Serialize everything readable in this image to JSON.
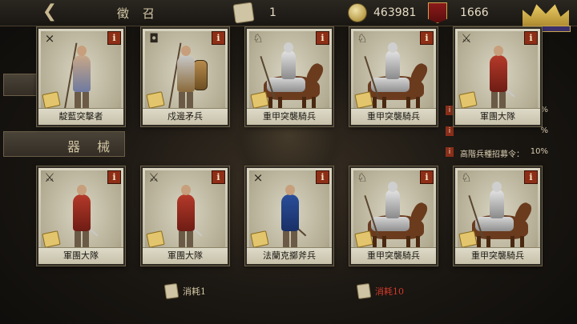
{
  "header": {
    "back_icon": "chevron-left-icon",
    "title": "徵 召",
    "scrolls": "1",
    "gold": "463981",
    "honor": "1666"
  },
  "side": {
    "equipment_label": "器 械"
  },
  "info": {
    "rows": [
      {
        "text": "",
        "pct": "%"
      },
      {
        "text": "",
        "pct": "%"
      },
      {
        "text": "高階兵種招募令：",
        "pct": "10%"
      }
    ]
  },
  "cards": [
    {
      "name": "靛藍突擊者",
      "icon": "crossbow",
      "figure": "infantry"
    },
    {
      "name": "戍邊矛兵",
      "icon": "shield",
      "figure": "spearman"
    },
    {
      "name": "重甲突襲騎兵",
      "icon": "cavalry",
      "figure": "cavalry"
    },
    {
      "name": "重甲突襲騎兵",
      "icon": "cavalry",
      "figure": "cavalry"
    },
    {
      "name": "軍團大隊",
      "icon": "crossed-swords",
      "figure": "legion"
    },
    {
      "name": "軍團大隊",
      "icon": "crossed-swords",
      "figure": "legion"
    },
    {
      "name": "軍團大隊",
      "icon": "crossed-swords",
      "figure": "legion"
    },
    {
      "name": "法蘭克擲斧兵",
      "icon": "crossbow",
      "figure": "axeman"
    },
    {
      "name": "重甲突襲騎兵",
      "icon": "cavalry",
      "figure": "cavalry"
    },
    {
      "name": "重甲突襲騎兵",
      "icon": "cavalry",
      "figure": "cavalry"
    }
  ],
  "costs": {
    "left": "消耗1",
    "right": "消耗10"
  },
  "colors": {
    "info_red": "#8e2e16",
    "cost_red": "#d23a2a",
    "gold": "#c9a64b"
  }
}
